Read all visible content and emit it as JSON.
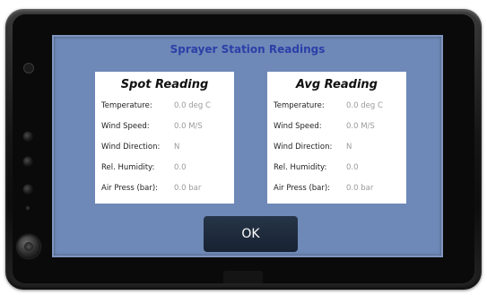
{
  "screen": {
    "title": "Sprayer Station Readings"
  },
  "spot": {
    "heading": "Spot Reading",
    "rows": [
      {
        "label": "Temperature:",
        "value": "0.0 deg C"
      },
      {
        "label": "Wind Speed:",
        "value": "0.0 M/S"
      },
      {
        "label": "Wind Direction:",
        "value": "N"
      },
      {
        "label": "Rel. Humidity:",
        "value": "0.0"
      },
      {
        "label": "Air Press (bar):",
        "value": "0.0 bar"
      }
    ]
  },
  "avg": {
    "heading": "Avg Reading",
    "rows": [
      {
        "label": "Temperature:",
        "value": "0.0 deg C"
      },
      {
        "label": "Wind Speed:",
        "value": "0.0 M/S"
      },
      {
        "label": "Wind Direction:",
        "value": "N"
      },
      {
        "label": "Rel. Humidity:",
        "value": "0.0"
      },
      {
        "label": "Air Press (bar):",
        "value": "0.0 bar"
      }
    ]
  },
  "buttons": {
    "ok_label": "OK"
  }
}
